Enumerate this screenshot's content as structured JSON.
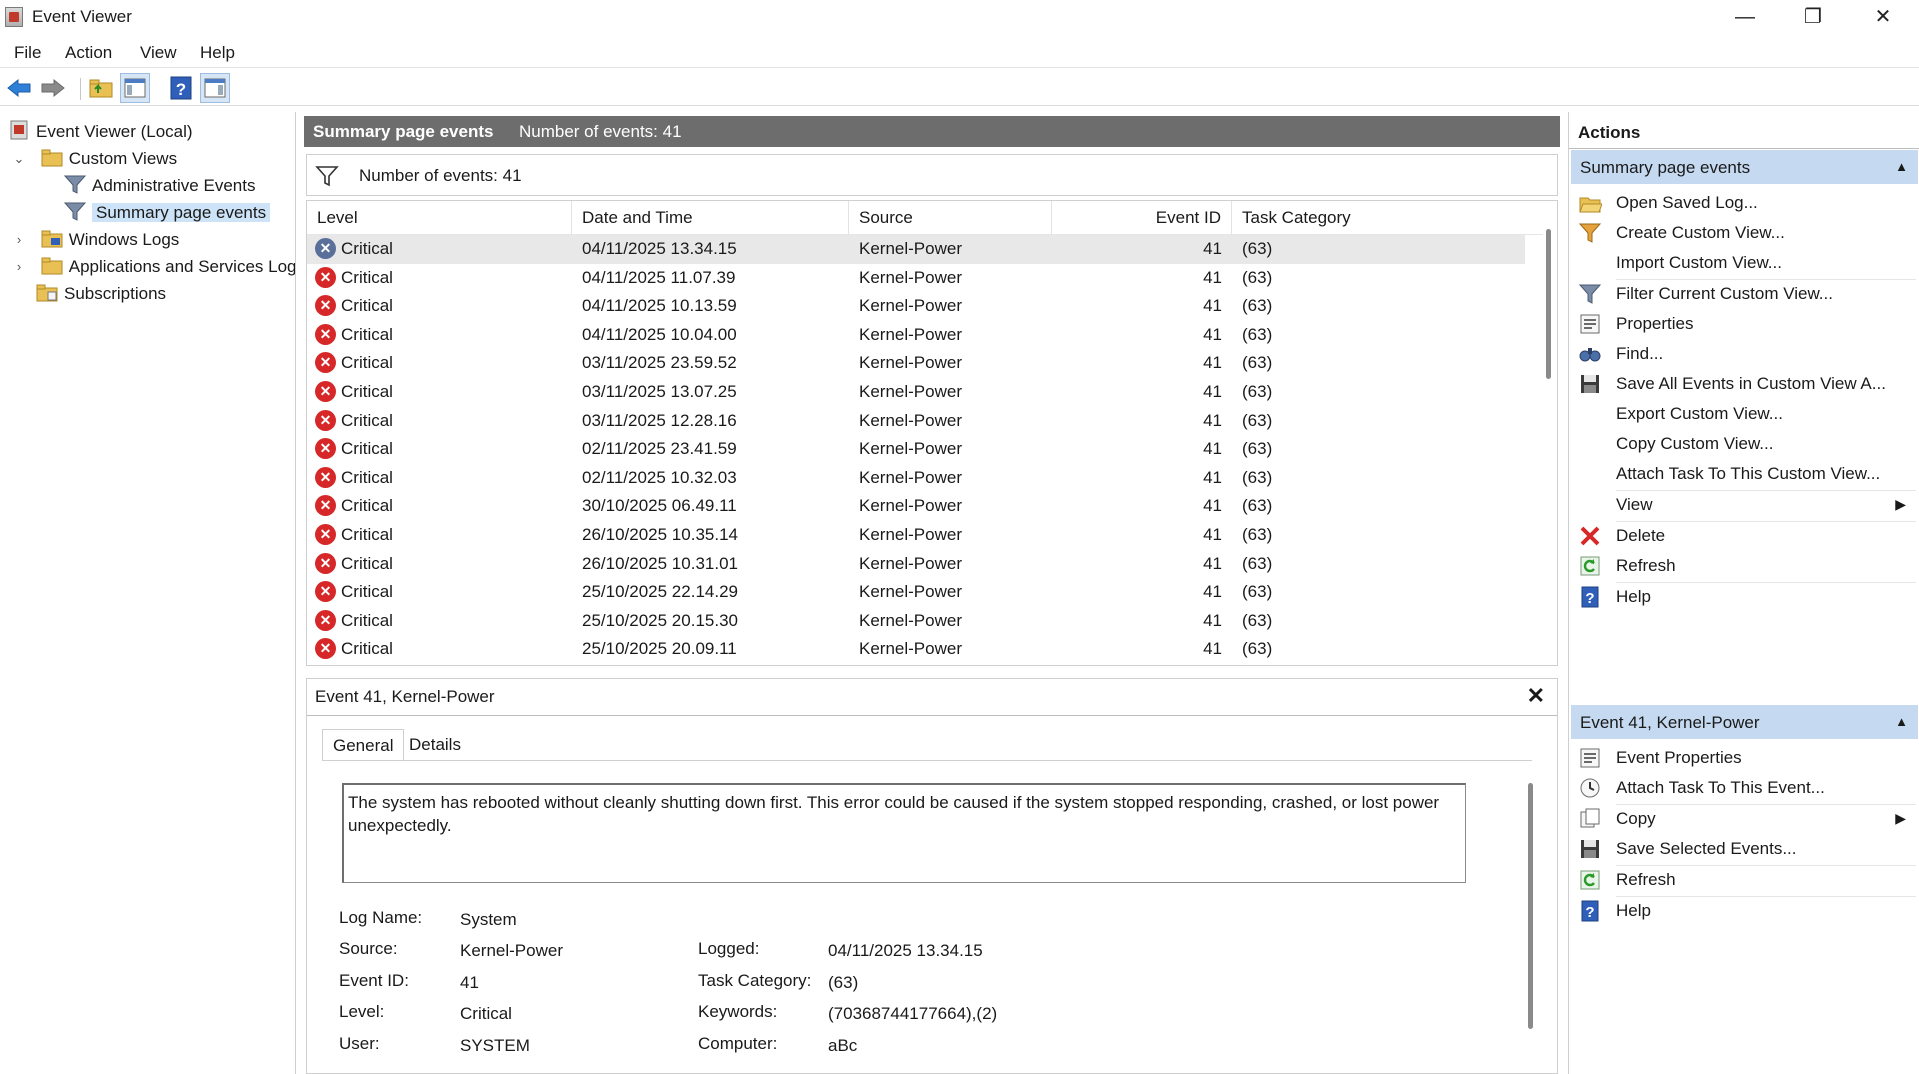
{
  "window": {
    "title": "Event Viewer",
    "minimize": "—",
    "restore": "❐",
    "close": "✕"
  },
  "menu": [
    "File",
    "Action",
    "View",
    "Help"
  ],
  "tree": {
    "root": "Event Viewer (Local)",
    "custom_views": "Custom Views",
    "administrative_events": "Administrative Events",
    "summary_page_events": "Summary page events",
    "windows_logs": "Windows Logs",
    "apps_services": "Applications and Services Logs",
    "subscriptions": "Subscriptions"
  },
  "center": {
    "title": "Summary page events",
    "count": "Number of events: 41",
    "filter_text": "Number of events: 41"
  },
  "table": {
    "columns": [
      "Level",
      "Date and Time",
      "Source",
      "Event ID",
      "Task Category"
    ],
    "rows": [
      {
        "level": "Critical",
        "date": "04/11/2025 13.34.15",
        "source": "Kernel-Power",
        "id": "41",
        "cat": "(63)"
      },
      {
        "level": "Critical",
        "date": "04/11/2025 11.07.39",
        "source": "Kernel-Power",
        "id": "41",
        "cat": "(63)"
      },
      {
        "level": "Critical",
        "date": "04/11/2025 10.13.59",
        "source": "Kernel-Power",
        "id": "41",
        "cat": "(63)"
      },
      {
        "level": "Critical",
        "date": "04/11/2025 10.04.00",
        "source": "Kernel-Power",
        "id": "41",
        "cat": "(63)"
      },
      {
        "level": "Critical",
        "date": "03/11/2025 23.59.52",
        "source": "Kernel-Power",
        "id": "41",
        "cat": "(63)"
      },
      {
        "level": "Critical",
        "date": "03/11/2025 13.07.25",
        "source": "Kernel-Power",
        "id": "41",
        "cat": "(63)"
      },
      {
        "level": "Critical",
        "date": "03/11/2025 12.28.16",
        "source": "Kernel-Power",
        "id": "41",
        "cat": "(63)"
      },
      {
        "level": "Critical",
        "date": "02/11/2025 23.41.59",
        "source": "Kernel-Power",
        "id": "41",
        "cat": "(63)"
      },
      {
        "level": "Critical",
        "date": "02/11/2025 10.32.03",
        "source": "Kernel-Power",
        "id": "41",
        "cat": "(63)"
      },
      {
        "level": "Critical",
        "date": "30/10/2025 06.49.11",
        "source": "Kernel-Power",
        "id": "41",
        "cat": "(63)"
      },
      {
        "level": "Critical",
        "date": "26/10/2025 10.35.14",
        "source": "Kernel-Power",
        "id": "41",
        "cat": "(63)"
      },
      {
        "level": "Critical",
        "date": "26/10/2025 10.31.01",
        "source": "Kernel-Power",
        "id": "41",
        "cat": "(63)"
      },
      {
        "level": "Critical",
        "date": "25/10/2025 22.14.29",
        "source": "Kernel-Power",
        "id": "41",
        "cat": "(63)"
      },
      {
        "level": "Critical",
        "date": "25/10/2025 20.15.30",
        "source": "Kernel-Power",
        "id": "41",
        "cat": "(63)"
      },
      {
        "level": "Critical",
        "date": "25/10/2025 20.09.11",
        "source": "Kernel-Power",
        "id": "41",
        "cat": "(63)"
      }
    ]
  },
  "details": {
    "title": "Event 41, Kernel-Power",
    "tabs": [
      "General",
      "Details"
    ],
    "description": "The system has rebooted without cleanly shutting down first. This error could be caused if the system stopped responding, crashed, or lost power unexpectedly.",
    "labels": {
      "log_name": "Log Name:",
      "source": "Source:",
      "event_id": "Event ID:",
      "level": "Level:",
      "user": "User:",
      "logged": "Logged:",
      "task_category": "Task Category:",
      "keywords": "Keywords:",
      "computer": "Computer:"
    },
    "values": {
      "log_name": "System",
      "source": "Kernel-Power",
      "event_id": "41",
      "level": "Critical",
      "user": "SYSTEM",
      "logged": "04/11/2025 13.34.15",
      "task_category": "(63)",
      "keywords": "(70368744177664),(2)",
      "computer": "aBc"
    }
  },
  "actions": {
    "title": "Actions",
    "group1": "Summary page events",
    "group1_items": [
      "Open Saved Log...",
      "Create Custom View...",
      "Import Custom View...",
      "Filter Current Custom View...",
      "Properties",
      "Find...",
      "Save All Events in Custom View A...",
      "Export Custom View...",
      "Copy Custom View...",
      "Attach Task To This Custom View...",
      "View",
      "Delete",
      "Refresh",
      "Help"
    ],
    "group2": "Event 41, Kernel-Power",
    "group2_items": [
      "Event Properties",
      "Attach Task To This Event...",
      "Copy",
      "Save Selected Events...",
      "Refresh",
      "Help"
    ]
  },
  "colors": {
    "accent": "#c5daf1",
    "critical": "#d62828",
    "header_bg": "#6d6d6d"
  }
}
